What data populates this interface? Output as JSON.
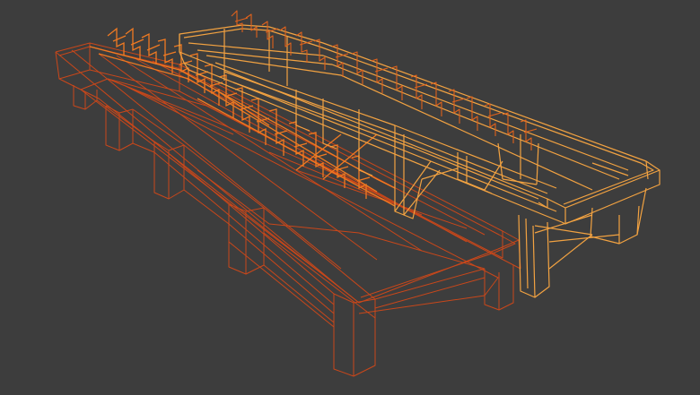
{
  "viewport": {
    "background": "#3d3d3d",
    "shading": "wireframe"
  },
  "model": {
    "unselected_color": "#c9471a",
    "active_color": "#f2a241",
    "selected_color": "#e0621c"
  }
}
